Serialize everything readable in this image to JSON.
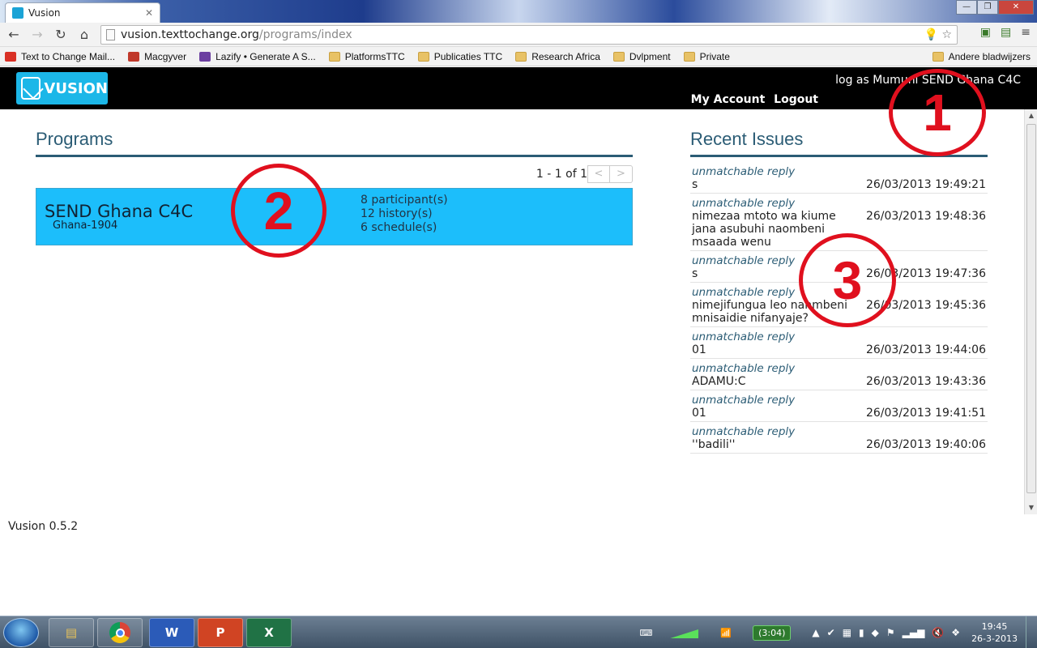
{
  "browser": {
    "tab_title": "Vusion",
    "url_host": "vusion.texttochange.org",
    "url_path": "/programs/index",
    "bookmarks": [
      {
        "label": "Text to Change Mail...",
        "icon": "gmail-icon",
        "color": "#d93025"
      },
      {
        "label": "Macgyver",
        "icon": "app-icon",
        "color": "#c0392b"
      },
      {
        "label": "Lazify • Generate A S...",
        "icon": "lazify-icon",
        "color": "#6b3fa0"
      },
      {
        "label": "PlatformsTTC",
        "icon": "folder-icon"
      },
      {
        "label": "Publicaties TTC",
        "icon": "folder-icon"
      },
      {
        "label": "Research Africa",
        "icon": "folder-icon"
      },
      {
        "label": "Dvlpment",
        "icon": "folder-icon"
      },
      {
        "label": "Private",
        "icon": "folder-icon"
      }
    ],
    "other_bookmarks": "Andere bladwijzers"
  },
  "header": {
    "logo_text": "VUSION",
    "login_as": "log as Mumuni SEND Ghana C4C",
    "my_account": "My Account",
    "logout": "Logout"
  },
  "programs": {
    "title": "Programs",
    "pager": "1 - 1 of 1",
    "prev": "<",
    "next": ">",
    "items": [
      {
        "name": "SEND Ghana C4C",
        "code": "Ghana-1904",
        "participants": "8 participant(s)",
        "history": "12 history(s)",
        "schedules": "6 schedule(s)"
      }
    ]
  },
  "recent_issues": {
    "title": "Recent Issues",
    "items": [
      {
        "type": "unmatchable reply",
        "message": "s",
        "timestamp": "26/03/2013 19:49:21"
      },
      {
        "type": "unmatchable reply",
        "message": "nimezaa mtoto wa kiume jana asubuhi naombeni msaada wenu",
        "timestamp": "26/03/2013 19:48:36"
      },
      {
        "type": "unmatchable reply",
        "message": "s",
        "timestamp": "26/03/2013 19:47:36"
      },
      {
        "type": "unmatchable reply",
        "message": "nimejifungua leo nanmbeni mnisaidie nifanyaje?",
        "timestamp": "26/03/2013 19:45:36"
      },
      {
        "type": "unmatchable reply",
        "message": "01",
        "timestamp": "26/03/2013 19:44:06"
      },
      {
        "type": "unmatchable reply",
        "message": "ADAMU:C",
        "timestamp": "26/03/2013 19:43:36"
      },
      {
        "type": "unmatchable reply",
        "message": "01",
        "timestamp": "26/03/2013 19:41:51"
      },
      {
        "type": "unmatchable reply",
        "message": "''badili''",
        "timestamp": "26/03/2013 19:40:06"
      }
    ]
  },
  "footer": {
    "version": "Vusion 0.5.2"
  },
  "annotations": [
    "1",
    "2",
    "3"
  ],
  "taskbar": {
    "apps": [
      "explorer-icon",
      "chrome-icon",
      "word-icon",
      "powerpoint-icon",
      "excel-icon"
    ],
    "battery": "(3:04)",
    "time": "19:45",
    "date": "26-3-2013"
  },
  "colors": {
    "accent": "#1cbefb",
    "title": "#2b5c75",
    "annotation": "#e0101e"
  }
}
